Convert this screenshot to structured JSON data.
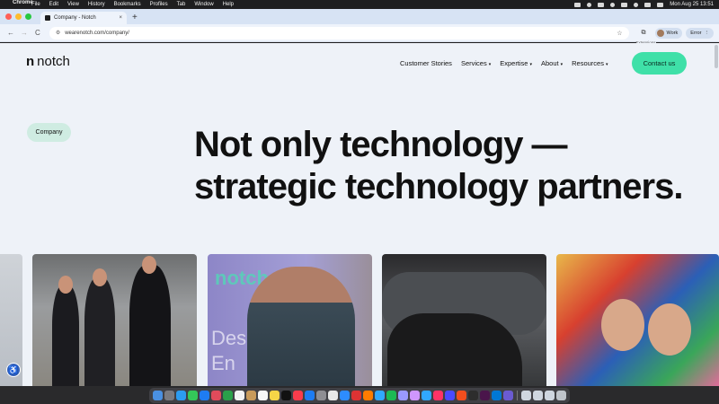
{
  "menubar": {
    "items": [
      "Chrome",
      "File",
      "Edit",
      "View",
      "History",
      "Bookmarks",
      "Profiles",
      "Tab",
      "Window",
      "Help"
    ],
    "datetime": "Mon Aug 25  13:51"
  },
  "tab": {
    "title": "Company - Notch",
    "close": "×",
    "new_tab": "+"
  },
  "toolbar": {
    "back": "←",
    "forward": "→",
    "reload": "C",
    "url": "wearenotch.com/company/",
    "star": "☆",
    "extensions_icon": "⧉",
    "extensions_tooltip": "Extensions",
    "profile_label": "Work",
    "error_label": "Error",
    "menu_dots": "⋮"
  },
  "site": {
    "logo_mark": "n",
    "logo_text": "notch",
    "nav": [
      {
        "label": "Customer Stories",
        "dropdown": false
      },
      {
        "label": "Services",
        "dropdown": true
      },
      {
        "label": "Expertise",
        "dropdown": true
      },
      {
        "label": "About",
        "dropdown": true
      },
      {
        "label": "Resources",
        "dropdown": true
      }
    ],
    "cta": "Contact us",
    "pill": "Company",
    "headline_line1": "Not only technology —",
    "headline_line2": "strategic technology partners.",
    "photo3_brand": "notch",
    "photo3_sign": "Desi\nEn"
  },
  "colors": {
    "accent": "#3fe0a8",
    "pill_bg": "#cfece2",
    "page_bg": "#eef2f8"
  },
  "accessibility_icon": "♿"
}
